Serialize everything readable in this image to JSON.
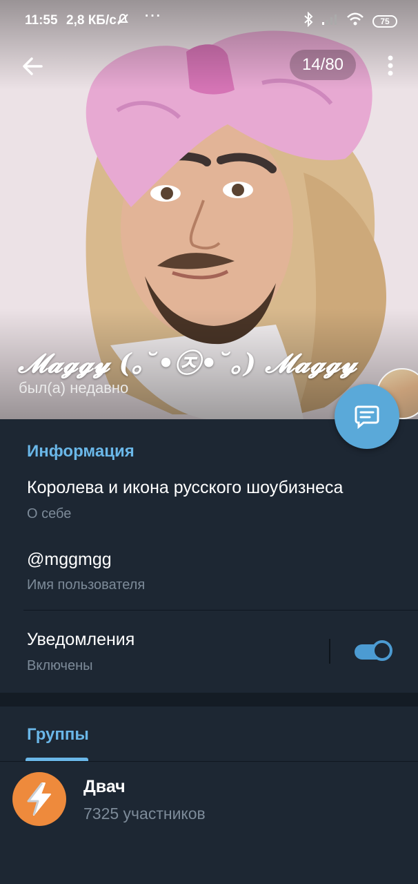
{
  "status_bar": {
    "time": "11:55",
    "speed": "2,8 КБ/с",
    "more": "···",
    "battery": "75"
  },
  "toolbar": {
    "counter": "14/80"
  },
  "profile": {
    "name": "𝓜𝓪𝓰𝓰𝔂 (｡˘•㉨•˘｡) 𝓜𝓪𝓰𝓰𝔂",
    "last_seen": "был(а) недавно"
  },
  "info": {
    "title": "Информация",
    "bio": "Королева и икона русского шоубизнеса",
    "bio_label": "О себе",
    "username": "@mggmgg",
    "username_label": "Имя пользователя",
    "notifications": "Уведомления",
    "notifications_status": "Включены",
    "notifications_on": true
  },
  "groups": {
    "title": "Группы",
    "items": [
      {
        "name": "Двач",
        "members": "7325 участников"
      }
    ]
  },
  "colors": {
    "accent": "#6ab7e8",
    "fab": "#5aa9d9",
    "background": "#1d2733",
    "group_avatar": "#ee8a3c"
  }
}
